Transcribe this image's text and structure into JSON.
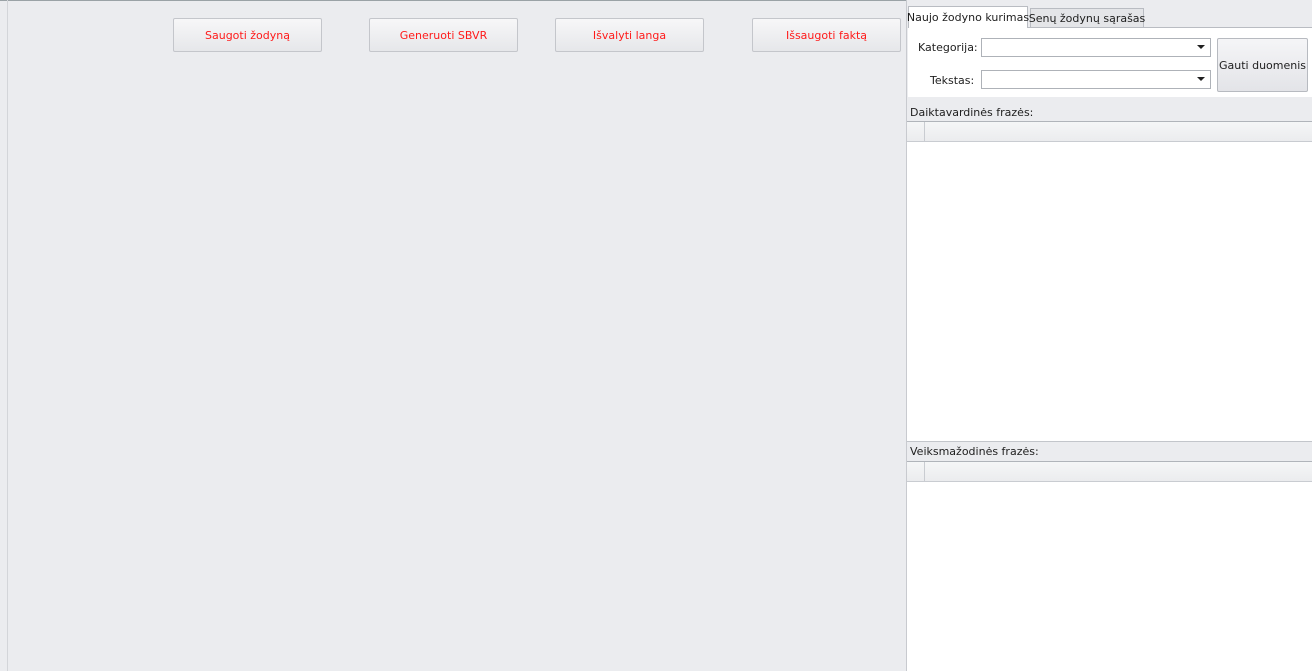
{
  "toolbar": {
    "save_dictionary_label": "Saugoti žodyną",
    "generate_sbvr_label": "Generuoti SBVR",
    "clear_window_label": "Išvalyti langa",
    "save_fact_label": "Išsaugoti faktą",
    "button_text_color": "#ff1a1a"
  },
  "tabs": [
    {
      "label": "Naujo žodyno kurimas",
      "active": true
    },
    {
      "label": "Senų žodynų sąrašas",
      "active": false
    }
  ],
  "form": {
    "category_label": "Kategorija:",
    "category_value": "",
    "text_label": "Tekstas:",
    "text_value": "",
    "get_data_label": "Gauti duomenis"
  },
  "sections": {
    "noun_phrases_label": "Daiktavardinės frazės:",
    "verb_phrases_label": "Veiksmažodinės frazės:"
  }
}
